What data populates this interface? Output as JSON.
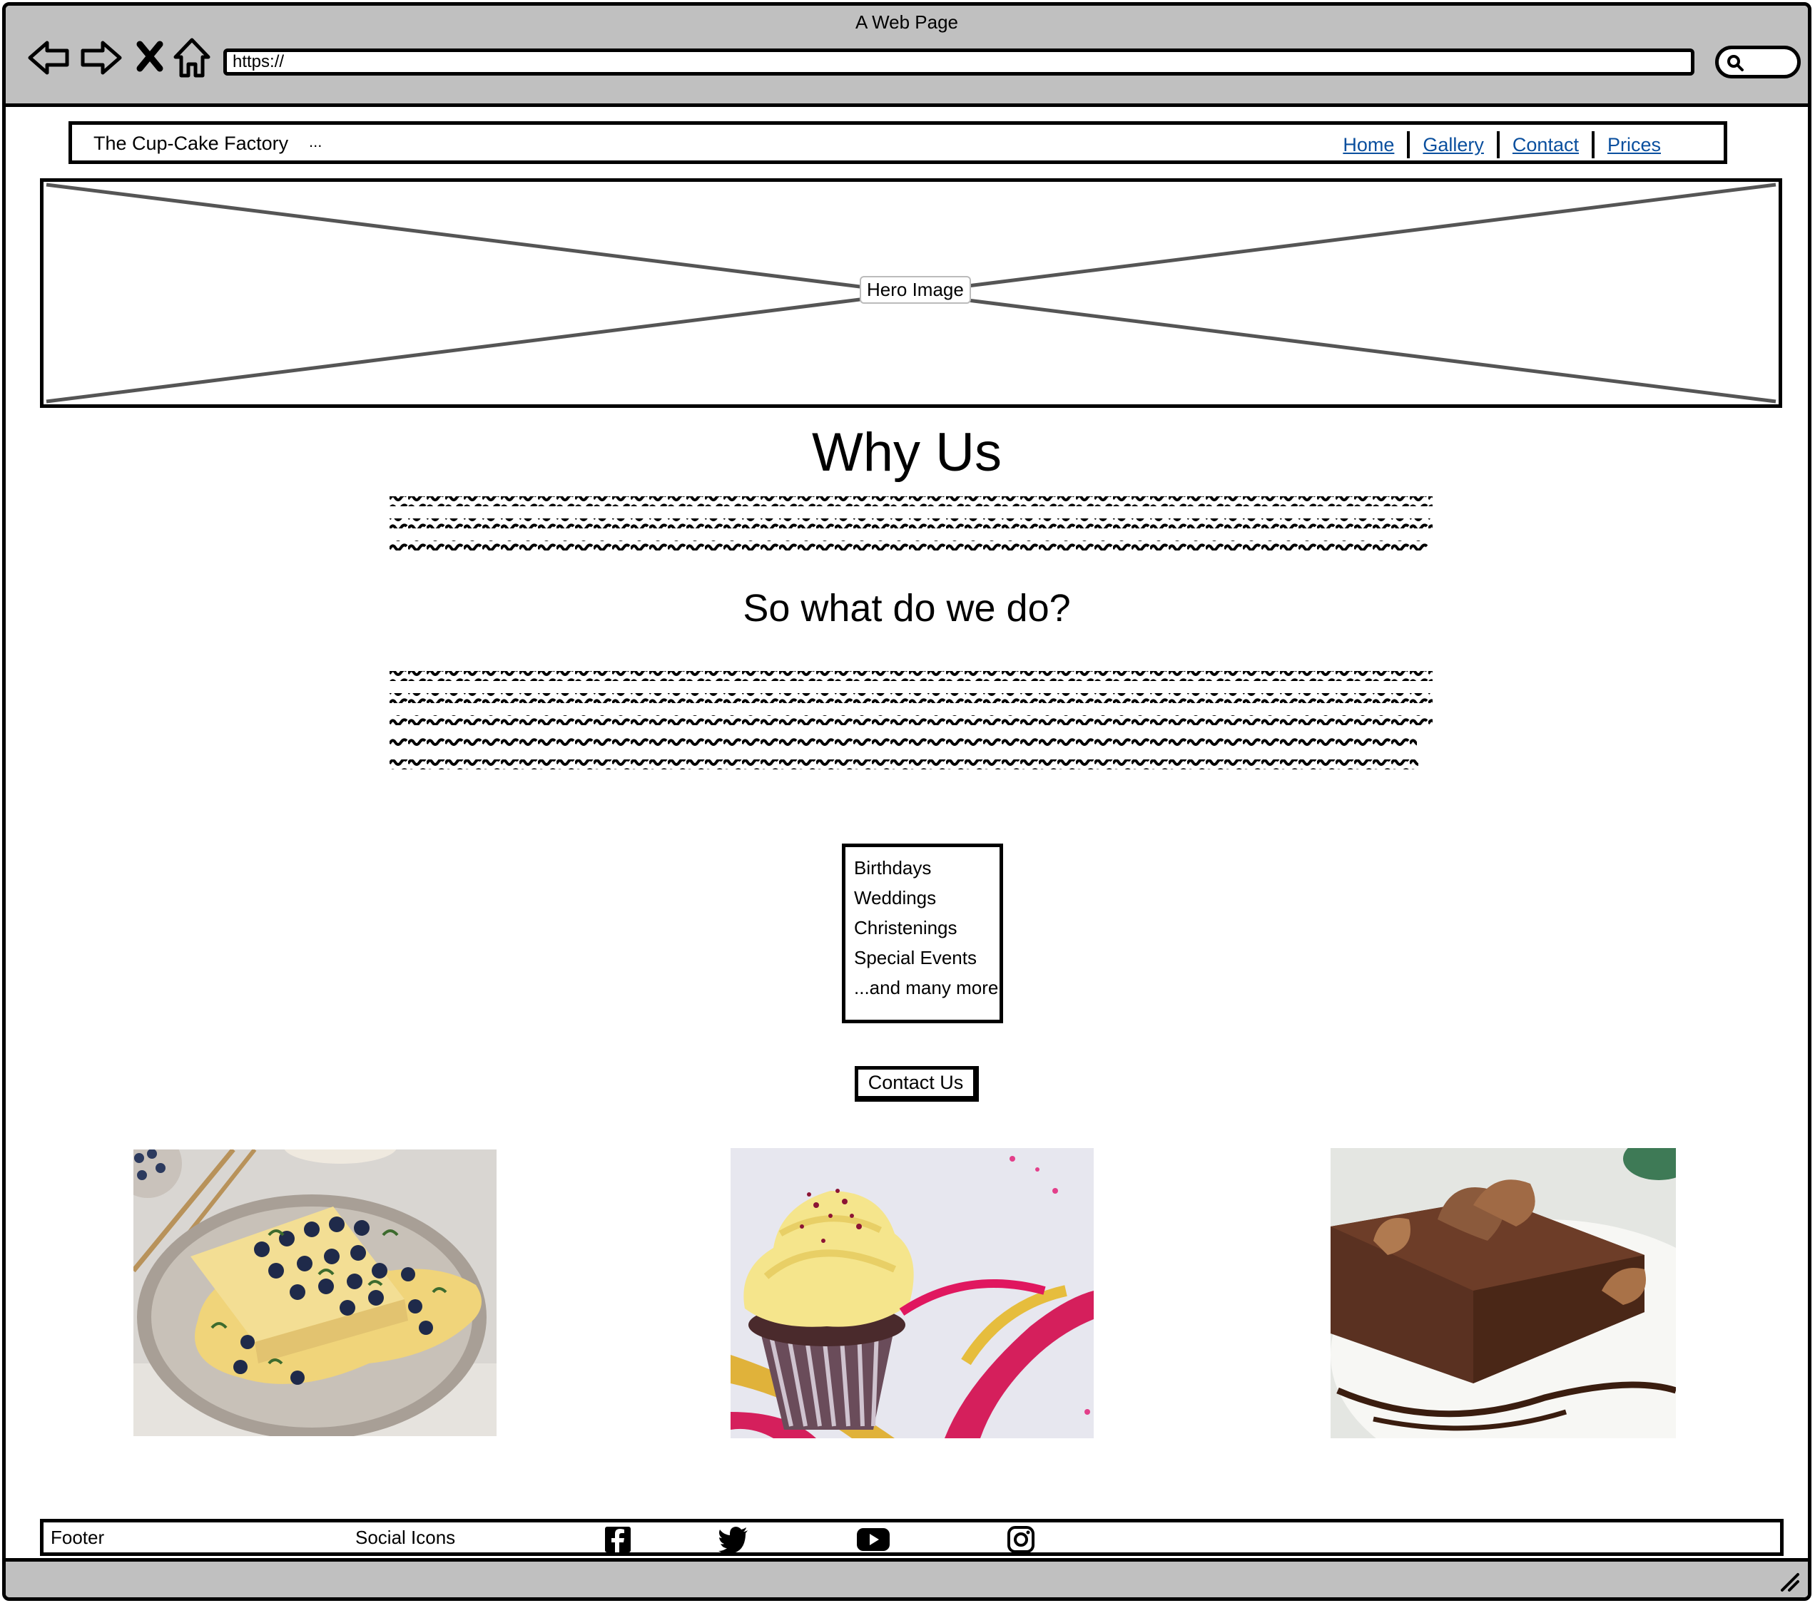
{
  "browser": {
    "window_title": "A Web Page",
    "url": "https://",
    "nav_icons": [
      "back-arrow-icon",
      "forward-arrow-icon",
      "stop-icon",
      "home-icon"
    ],
    "search_icon": "search-icon"
  },
  "navbar": {
    "brand": "The Cup-Cake Factory",
    "ellipsis": "...",
    "links": [
      "Home",
      "Gallery",
      "Contact",
      "Prices"
    ]
  },
  "hero": {
    "label": "Hero Image"
  },
  "main": {
    "title": "Why Us",
    "subtitle": "So what do we do?",
    "services": [
      "Birthdays",
      "Weddings",
      "Christenings",
      "Special Events",
      "...and many more"
    ],
    "cta_label": "Contact Us"
  },
  "gallery": {
    "images": [
      "blueberry-custard-cake-photo",
      "cupcake-with-ribbon-photo",
      "chocolate-cake-slice-photo"
    ]
  },
  "footer": {
    "label": "Footer",
    "social_label": "Social Icons",
    "social_icons": [
      "facebook-icon",
      "twitter-icon",
      "youtube-icon",
      "instagram-icon"
    ]
  },
  "colors": {
    "chrome": "#c0c0c0",
    "link": "#0a4f9e"
  }
}
